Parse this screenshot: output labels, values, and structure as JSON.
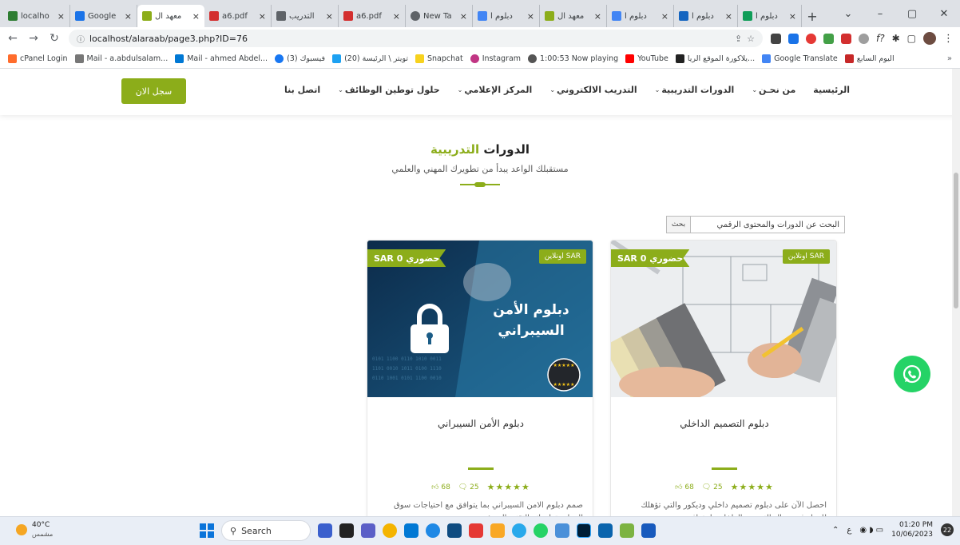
{
  "browser": {
    "tabs": [
      {
        "title": "localho",
        "color": "#2e7d32"
      },
      {
        "title": "Google",
        "color": "#1a73e8"
      },
      {
        "title": "معهد ال",
        "color": "#8cad1a",
        "active": true
      },
      {
        "title": "a6.pdf",
        "color": "#d32f2f"
      },
      {
        "title": "التدريب",
        "color": "#5f6368"
      },
      {
        "title": "a6.pdf",
        "color": "#d32f2f"
      },
      {
        "title": "New Ta",
        "color": "#5f6368"
      },
      {
        "title": "دبلوم ا",
        "color": "#4285f4"
      },
      {
        "title": "معهد ال",
        "color": "#8cad1a"
      },
      {
        "title": "دبلوم ا",
        "color": "#4285f4"
      },
      {
        "title": "دبلوم ا",
        "color": "#1565c0"
      },
      {
        "title": "دبلوم ا",
        "color": "#0f9d58"
      }
    ],
    "new_tab": "+",
    "url": "localhost/alaraab/page3.php?ID=76",
    "bookmarks": [
      {
        "label": "cPanel Login",
        "color": "#ff6c2c"
      },
      {
        "label": "Mail - a.abdulsalam...",
        "color": "#777777"
      },
      {
        "label": "Mail - ahmed Abdel...",
        "color": "#0078d4"
      },
      {
        "label": "(3) فيسبوك",
        "color": "#1877f2"
      },
      {
        "label": "(20) تويتر \\ الرئيسة",
        "color": "#1da1f2"
      },
      {
        "label": "Snapchat",
        "color": "#f7d21e"
      },
      {
        "label": "Instagram",
        "color": "#c13584"
      },
      {
        "label": "1:00:53 Now playing",
        "color": "#555555"
      },
      {
        "label": "YouTube",
        "color": "#ff0000"
      },
      {
        "label": "يلاكورة الموقع الريا...",
        "color": "#222222"
      },
      {
        "label": "Google Translate",
        "color": "#4285f4"
      },
      {
        "label": "اليوم السابع",
        "color": "#c62828"
      }
    ]
  },
  "site": {
    "register_label": "سجل الان",
    "menu": [
      {
        "label": "الرئيسية",
        "caret": false
      },
      {
        "label": "من نحـن",
        "caret": true
      },
      {
        "label": "الدورات التدريبية",
        "caret": true
      },
      {
        "label": "التدريب الالكتروني",
        "caret": true
      },
      {
        "label": "المركز الإعلامي",
        "caret": true
      },
      {
        "label": "حلول توطين الوظائف",
        "caret": true
      },
      {
        "label": "اتصل بنا",
        "caret": false
      }
    ],
    "section_title_part1": "الدورات",
    "section_title_part2": "التدريبية",
    "section_subtitle": "مستقبلك الواعد يبدأ من تطويرك المهني والعلمي",
    "search_placeholder": "البحث عن الدورات والمحتوى الرقمي",
    "search_button": "بحث",
    "accent": "#8cad1a"
  },
  "cards": [
    {
      "online_badge": "اونلاين SAR",
      "price_badge": "حضوري 0 SAR",
      "image_caption_1": "دبلوم الأمن",
      "image_caption_2": "السيبراني",
      "title": "دبلوم الأمن السيبراني",
      "stars": "★★★★★",
      "comments": "25",
      "likes": "68",
      "description": "صمم دبلوم الامن السيبراني بما يتوافق مع احتياجات سوق العمل وتطوراته التقنية الحديثة"
    },
    {
      "online_badge": "اونلاين SAR",
      "price_badge": "حضوري 0 SAR",
      "title": "دبلوم التصميم الداخلي",
      "stars": "★★★★★",
      "comments": "25",
      "likes": "68",
      "description": "احصل الآن على دبلوم تصميم داخلي وديكور والتي تؤهلك للعمل في مجال التصميم الداخلي باحترافية"
    }
  ],
  "taskbar": {
    "temp": "40°C",
    "weather_desc": "مشمس",
    "search_label": "Search",
    "time": "01:20 PM",
    "date": "10/06/2023",
    "notifications": "22",
    "lang": "ع"
  }
}
